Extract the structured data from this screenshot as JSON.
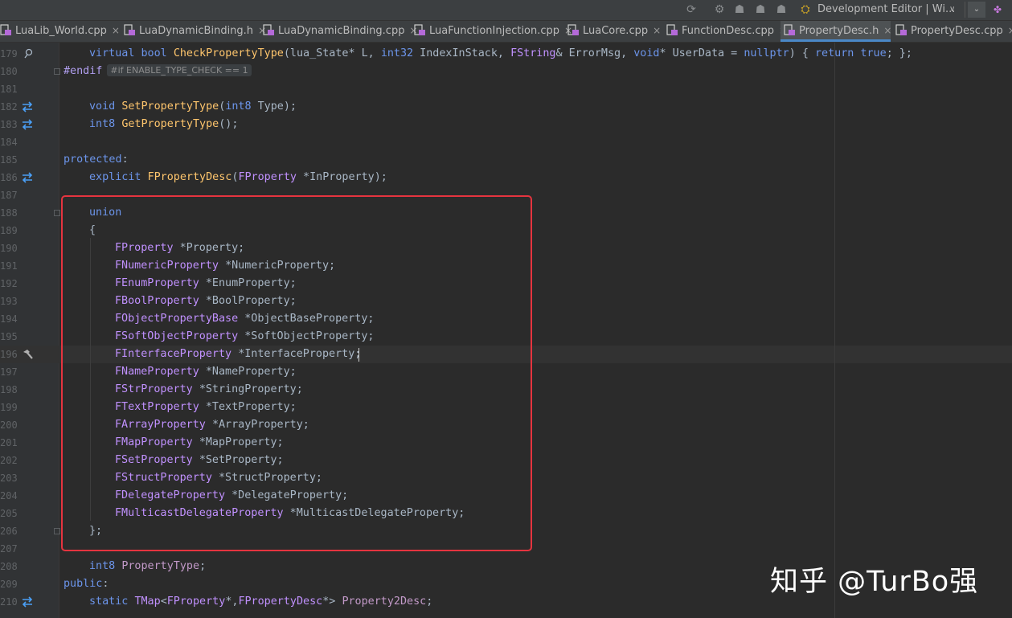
{
  "toolbar": {
    "icons": [
      "refresh-icon",
      "build-icon",
      "debug-icon",
      "profile-icon",
      "run-config-icon",
      "unreal-icon"
    ],
    "configuration": "Development Editor | Wi...",
    "caret": "∨",
    "overflow": "⌄"
  },
  "tabs": [
    {
      "label": "LuaLib_World.cpp",
      "active": false
    },
    {
      "label": "LuaDynamicBinding.h",
      "active": false
    },
    {
      "label": "LuaDynamicBinding.cpp",
      "active": false
    },
    {
      "label": "LuaFunctionInjection.cpp",
      "active": false
    },
    {
      "label": "LuaCore.cpp",
      "active": false
    },
    {
      "label": "FunctionDesc.cpp",
      "active": false
    },
    {
      "label": "PropertyDesc.h",
      "active": true
    },
    {
      "label": "PropertyDesc.cpp",
      "active": false
    }
  ],
  "close_glyph": "×",
  "line_numbers": [
    "179",
    "180",
    "181",
    "182",
    "183",
    "184",
    "185",
    "186",
    "187",
    "188",
    "189",
    "190",
    "191",
    "192",
    "193",
    "194",
    "195",
    "196",
    "197",
    "198",
    "199",
    "200",
    "201",
    "202",
    "203",
    "204",
    "205",
    "206",
    "207",
    "208",
    "209",
    "210"
  ],
  "code": {
    "l179": {
      "a": "virtual",
      "b": "bool",
      "c": "CheckPropertyType",
      "d": "(lua_State* L, ",
      "e": "int32",
      "f": " IndexInStack, ",
      "g": "FString",
      "h": "& ErrorMsg, ",
      "i": "void",
      "j": "* UserData = ",
      "k": "nullptr",
      "l": ") { ",
      "m": "return",
      "n": "true",
      "o": "; };"
    },
    "l180": {
      "a": "#endif",
      "hint": "#if ENABLE_TYPE_CHECK == 1"
    },
    "l182": {
      "a": "void",
      "b": "SetPropertyType",
      "c": "(",
      "d": "int8",
      "e": " Type);"
    },
    "l183": {
      "a": "int8",
      "b": "GetPropertyType",
      "c": "();"
    },
    "l185": {
      "a": "protected",
      "b": ":"
    },
    "l186": {
      "a": "explicit",
      "b": "FPropertyDesc",
      "c": "(",
      "d": "FProperty",
      "e": " *InProperty);"
    },
    "l188": {
      "a": "union"
    },
    "l189": {
      "a": "{"
    },
    "union_members": [
      {
        "type": "FProperty",
        "name": "*Property;"
      },
      {
        "type": "FNumericProperty",
        "name": "*NumericProperty;"
      },
      {
        "type": "FEnumProperty",
        "name": "*EnumProperty;"
      },
      {
        "type": "FBoolProperty",
        "name": "*BoolProperty;"
      },
      {
        "type": "FObjectPropertyBase",
        "name": "*ObjectBaseProperty;"
      },
      {
        "type": "FSoftObjectProperty",
        "name": "*SoftObjectProperty;"
      },
      {
        "type": "FInterfaceProperty",
        "name": "*InterfaceProperty;"
      },
      {
        "type": "FNameProperty",
        "name": "*NameProperty;"
      },
      {
        "type": "FStrProperty",
        "name": "*StringProperty;"
      },
      {
        "type": "FTextProperty",
        "name": "*TextProperty;"
      },
      {
        "type": "FArrayProperty",
        "name": "*ArrayProperty;"
      },
      {
        "type": "FMapProperty",
        "name": "*MapProperty;"
      },
      {
        "type": "FSetProperty",
        "name": "*SetProperty;"
      },
      {
        "type": "FStructProperty",
        "name": "*StructProperty;"
      },
      {
        "type": "FDelegateProperty",
        "name": "*DelegateProperty;"
      },
      {
        "type": "FMulticastDelegateProperty",
        "name": "*MulticastDelegateProperty;"
      }
    ],
    "l206": {
      "a": "};"
    },
    "l208": {
      "a": "int8",
      "b": "PropertyType",
      "c": ";"
    },
    "l209": {
      "a": "public",
      "b": ":"
    },
    "l210": {
      "a": "static",
      "b": "TMap",
      "c": "<",
      "d": "FProperty",
      "e": "*,",
      "f": "FPropertyDesc",
      "g": "*> ",
      "h": "Property2Desc",
      "i": ";"
    }
  },
  "watermark": "知乎 @TurBo强",
  "colors": {
    "highlight_box": "#e5343f",
    "active_tab_underline": "#4a88c7",
    "background": "#2b2b2b"
  }
}
